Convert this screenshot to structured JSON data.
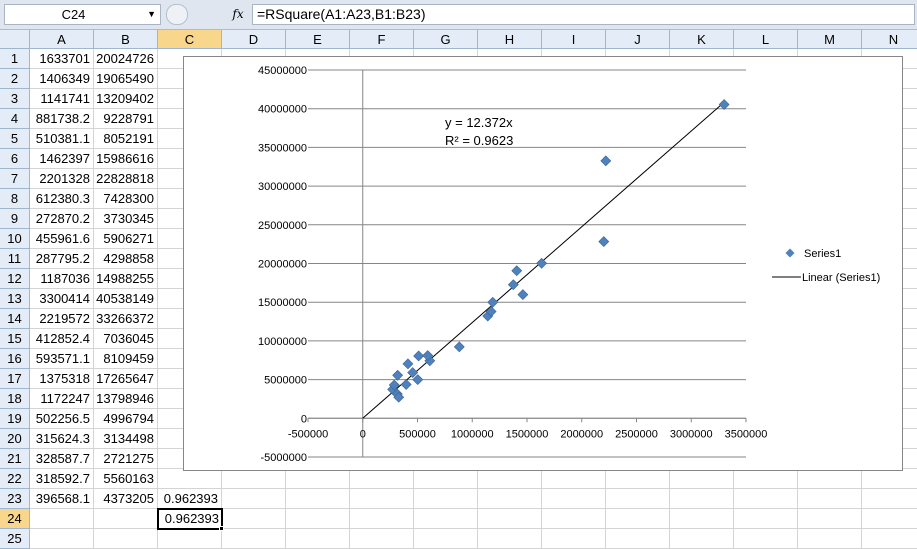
{
  "formula_bar": {
    "name_box": "C24",
    "fx_label": "fx",
    "formula": "=RSquare(A1:A23,B1:B23)"
  },
  "sheet": {
    "columns": [
      "A",
      "B",
      "C",
      "D",
      "E",
      "F",
      "G",
      "H",
      "I",
      "J",
      "K",
      "L",
      "M",
      "N"
    ],
    "active_column": "C",
    "row_count": 25,
    "active_row": 24,
    "rows": [
      [
        "1633701",
        "20024726",
        ""
      ],
      [
        "1406349",
        "19065490",
        ""
      ],
      [
        "1141741",
        "13209402",
        ""
      ],
      [
        "881738.2",
        "9228791",
        ""
      ],
      [
        "510381.1",
        "8052191",
        ""
      ],
      [
        "1462397",
        "15986616",
        ""
      ],
      [
        "2201328",
        "22828818",
        ""
      ],
      [
        "612380.3",
        "7428300",
        ""
      ],
      [
        "272870.2",
        "3730345",
        ""
      ],
      [
        "455961.6",
        "5906271",
        ""
      ],
      [
        "287795.2",
        "4298858",
        ""
      ],
      [
        "1187036",
        "14988255",
        ""
      ],
      [
        "3300414",
        "40538149",
        ""
      ],
      [
        "2219572",
        "33266372",
        ""
      ],
      [
        "412852.4",
        "7036045",
        ""
      ],
      [
        "593571.1",
        "8109459",
        ""
      ],
      [
        "1375318",
        "17265647",
        ""
      ],
      [
        "1172247",
        "13798946",
        ""
      ],
      [
        "502256.5",
        "4996794",
        ""
      ],
      [
        "315624.3",
        "3134498",
        ""
      ],
      [
        "328587.7",
        "2721275",
        ""
      ],
      [
        "318592.7",
        "5560163",
        ""
      ],
      [
        "396568.1",
        "4373205",
        "0.962393"
      ],
      [
        "",
        "",
        "0.962393"
      ],
      [
        "",
        "",
        ""
      ]
    ]
  },
  "chart_data": {
    "type": "scatter",
    "series": [
      {
        "name": "Series1",
        "color": "#4f81bd",
        "marker": "diamond",
        "points": [
          [
            1633701,
            20024726
          ],
          [
            1406349,
            19065490
          ],
          [
            1141741,
            13209402
          ],
          [
            881738.2,
            9228791
          ],
          [
            510381.1,
            8052191
          ],
          [
            1462397,
            15986616
          ],
          [
            2201328,
            22828818
          ],
          [
            612380.3,
            7428300
          ],
          [
            272870.2,
            3730345
          ],
          [
            455961.6,
            5906271
          ],
          [
            287795.2,
            4298858
          ],
          [
            1187036,
            14988255
          ],
          [
            3300414,
            40538149
          ],
          [
            2219572,
            33266372
          ],
          [
            412852.4,
            7036045
          ],
          [
            593571.1,
            8109459
          ],
          [
            1375318,
            17265647
          ],
          [
            1172247,
            13798946
          ],
          [
            502256.5,
            4996794
          ],
          [
            315624.3,
            3134498
          ],
          [
            328587.7,
            2721275
          ],
          [
            318592.7,
            5560163
          ],
          [
            396568.1,
            4373205
          ]
        ]
      }
    ],
    "trendline": {
      "name": "Linear (Series1)",
      "slope": 12.372,
      "intercept": 0,
      "x_range": [
        0,
        3300414
      ],
      "color": "#000000"
    },
    "annotations": [
      "y = 12.372x",
      "R² = 0.9623"
    ],
    "xlim": [
      -500000,
      3500000
    ],
    "ylim": [
      -5000000,
      45000000
    ],
    "x_ticks": [
      -500000,
      0,
      500000,
      1000000,
      1500000,
      2000000,
      2500000,
      3000000,
      3500000
    ],
    "y_ticks": [
      -5000000,
      0,
      5000000,
      10000000,
      15000000,
      20000000,
      25000000,
      30000000,
      35000000,
      40000000,
      45000000
    ],
    "x_tick_labels": [
      "-500000",
      "0",
      "500000",
      "1000000",
      "1500000",
      "2000000",
      "2500000",
      "3000000",
      "3500000"
    ],
    "y_tick_labels": [
      "-5000000",
      "0",
      "5000000",
      "10000000",
      "15000000",
      "20000000",
      "25000000",
      "30000000",
      "35000000",
      "40000000",
      "45000000"
    ],
    "grid": "horizontal",
    "legend": {
      "placement": "right",
      "entries": [
        "Series1",
        "Linear (Series1)"
      ]
    }
  }
}
